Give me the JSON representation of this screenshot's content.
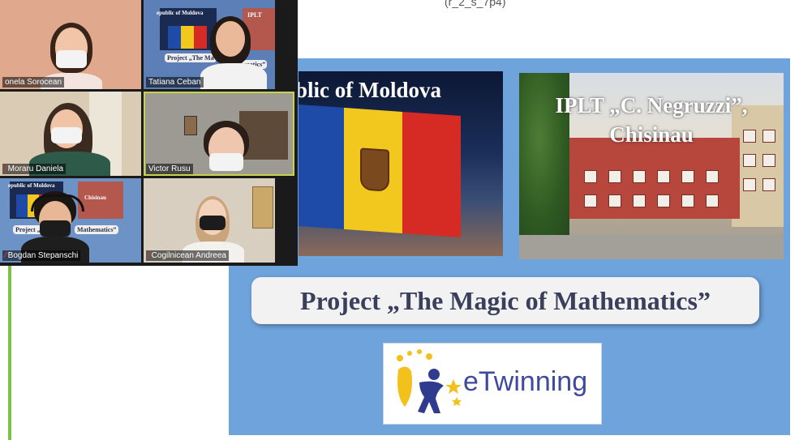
{
  "top_fragment": "(r_2_s_7p4)",
  "slide": {
    "moldova_title": "blic of Moldova",
    "school_title": "IPLT „C. Negruzzi”, Chisinau",
    "project_title": "Project  „The Magic of Mathematics”",
    "etwinning_label": "eTwinning"
  },
  "gallery": {
    "participants": [
      {
        "name": "onela Sorocean",
        "muted": false
      },
      {
        "name": "Tatiana Ceban",
        "muted": false
      },
      {
        "name": "Moraru Daniela",
        "muted": true
      },
      {
        "name": "Victor Rusu",
        "muted": false,
        "active": true
      },
      {
        "name": "Bogdan Stepanschi",
        "muted": true
      },
      {
        "name": "Cogilnicean Andreea",
        "muted": true
      }
    ],
    "shared_screen_text": {
      "moldova": "epublic of Moldova",
      "iplt": "IPLT",
      "chisinau": "Chisinau",
      "project_short": "Project  „The Ma",
      "project_tail": "matics”",
      "project_mid": "Project  „The",
      "project_mid_tail": "Mathematics”"
    }
  },
  "colors": {
    "slide_bg": "#6fa3dc",
    "accent_green": "#7cc242",
    "active_speaker_border": "#c8d34a",
    "muted_icon": "#e0332c"
  }
}
